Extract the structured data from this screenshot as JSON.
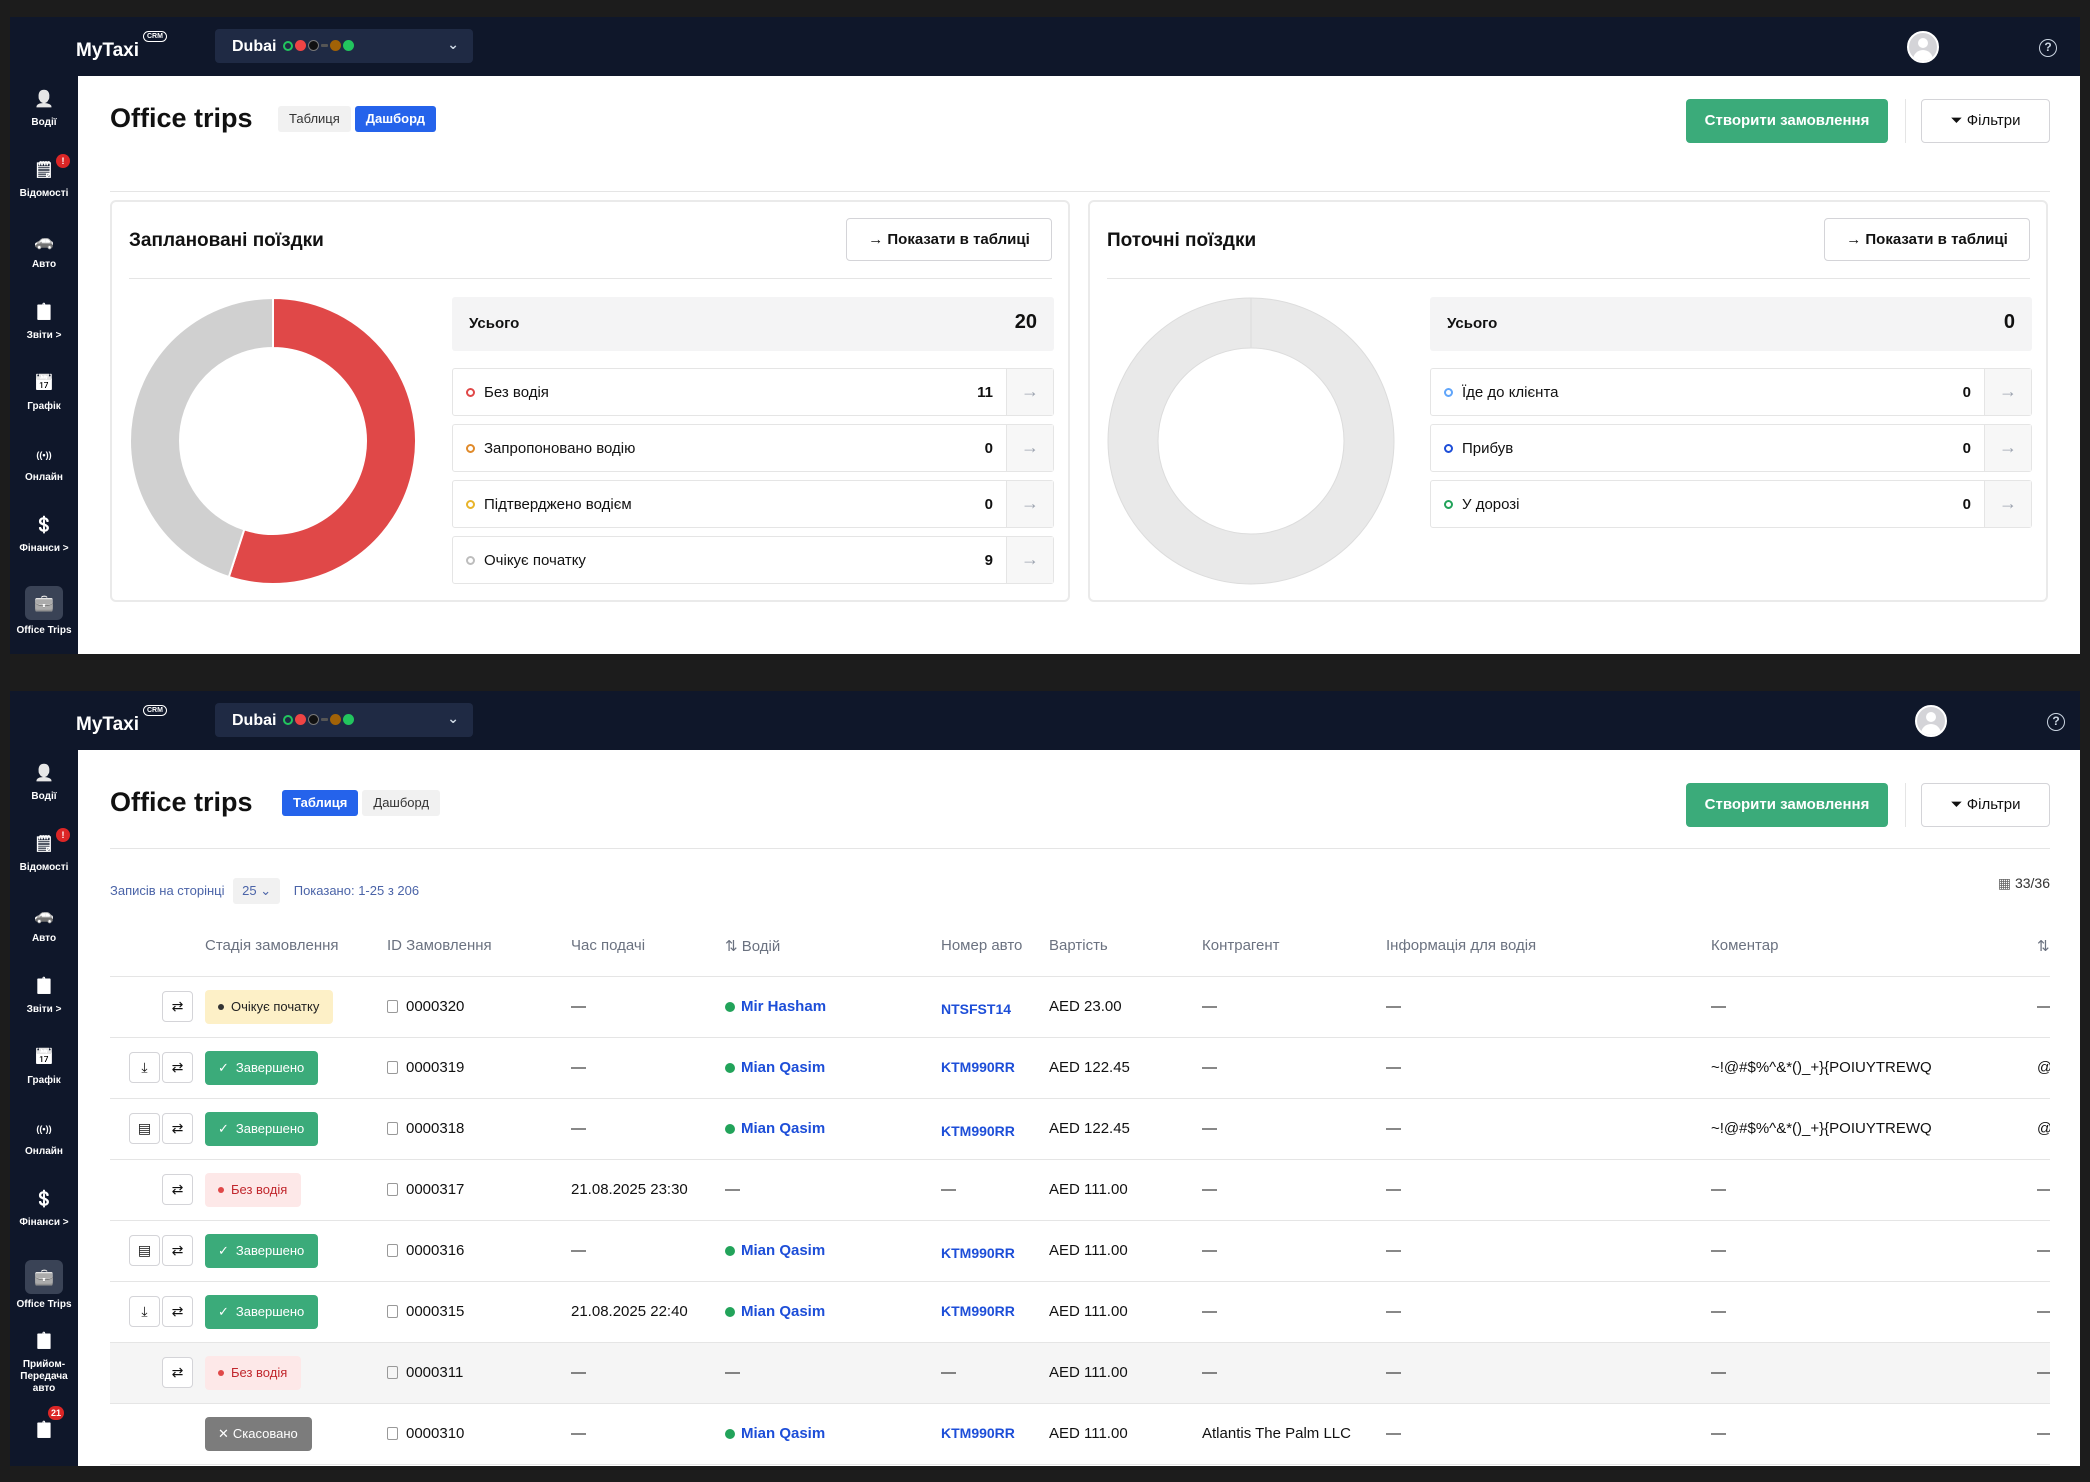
{
  "app": {
    "logo": "MyTaxi",
    "logo_badge": "CRM",
    "city": "Dubai"
  },
  "nav": [
    {
      "label": "Водії",
      "icon": "user-icon"
    },
    {
      "label": "Відомості",
      "icon": "statement-icon",
      "badge": "!"
    },
    {
      "label": "Авто",
      "icon": "car-icon"
    },
    {
      "label": "Звіти >",
      "icon": "report-icon"
    },
    {
      "label": "Графік",
      "icon": "calendar-icon"
    },
    {
      "label": "Онлайн",
      "icon": "broadcast-icon"
    },
    {
      "label": "Фінанси >",
      "icon": "finance-icon"
    },
    {
      "label": "Office Trips",
      "icon": "briefcase-icon",
      "active": true
    }
  ],
  "nav_extra": {
    "label": "Прийом-Передача авто",
    "badge": "21"
  },
  "page": {
    "title": "Office trips",
    "tab_table": "Таблиця",
    "tab_dashboard": "Дашборд",
    "create_btn": "Створити замовлення",
    "filter_btn": "Фільтри"
  },
  "dashboard": {
    "planned": {
      "title": "Заплановані поїздки",
      "show_btn": "Показати в таблиці",
      "total_label": "Усього",
      "total": "20",
      "rows": [
        {
          "label": "Без водія",
          "value": "11",
          "color": "#e04848"
        },
        {
          "label": "Запропоновано водію",
          "value": "0",
          "color": "#e08a2a"
        },
        {
          "label": "Підтверджено водієм",
          "value": "0",
          "color": "#e8b42a"
        },
        {
          "label": "Очікує початку",
          "value": "9",
          "color": "#bdbdbd"
        }
      ]
    },
    "current": {
      "title": "Поточні поїздки",
      "show_btn": "Показати в таблиці",
      "total_label": "Усього",
      "total": "0",
      "rows": [
        {
          "label": "Їде до клієнта",
          "value": "0",
          "color": "#60a5fa"
        },
        {
          "label": "Прибув",
          "value": "0",
          "color": "#1d4ed8"
        },
        {
          "label": "У дорозі",
          "value": "0",
          "color": "#22a35a"
        }
      ]
    }
  },
  "table": {
    "per_page_label": "Записів на сторінці",
    "per_page": "25",
    "shown": "Показано: 1-25 з 206",
    "columns_count": "33/36",
    "headers": [
      "Стадія замовлення",
      "ID Замовлення",
      "Час подачі",
      "Водій",
      "Номер авто",
      "Вартість",
      "Контрагент",
      "Інформація для водія",
      "Коментар"
    ],
    "rows": [
      {
        "stage": "Очікує початку",
        "kind": "wait",
        "id": "0000320",
        "time": "—",
        "driver": "Mir Hasham",
        "car": "NTSFST14",
        "cost": "AED 23.00",
        "counterparty": "—",
        "info": "—",
        "comment": "—",
        "last": "—",
        "act1": ""
      },
      {
        "stage": "Завершено",
        "kind": "done",
        "id": "0000319",
        "time": "—",
        "driver": "Mian Qasim",
        "car": "KTM990RR",
        "cost": "AED 122.45",
        "counterparty": "—",
        "info": "—",
        "comment": "~!@#$%^&*()_+}{POIUYTREWQ",
        "last": "@i",
        "act1": "⤓"
      },
      {
        "stage": "Завершено",
        "kind": "done",
        "id": "0000318",
        "time": "—",
        "driver": "Mian Qasim",
        "car": "KTM990RR",
        "cost": "AED 122.45",
        "counterparty": "—",
        "info": "—",
        "comment": "~!@#$%^&*()_+}{POIUYTREWQ",
        "last": "@i",
        "act1": "▤"
      },
      {
        "stage": "Без водія",
        "kind": "nod",
        "id": "0000317",
        "time": "21.08.2025 23:30",
        "driver": "—",
        "car": "—",
        "cost": "AED 111.00",
        "counterparty": "—",
        "info": "—",
        "comment": "—",
        "last": "—",
        "act1": ""
      },
      {
        "stage": "Завершено",
        "kind": "done",
        "id": "0000316",
        "time": "—",
        "driver": "Mian Qasim",
        "car": "KTM990RR",
        "cost": "AED 111.00",
        "counterparty": "—",
        "info": "—",
        "comment": "—",
        "last": "—",
        "act1": "▤"
      },
      {
        "stage": "Завершено",
        "kind": "done",
        "id": "0000315",
        "time": "21.08.2025 22:40",
        "driver": "Mian Qasim",
        "car": "KTM990RR",
        "cost": "AED 111.00",
        "counterparty": "—",
        "info": "—",
        "comment": "—",
        "last": "—",
        "act1": "⤓"
      },
      {
        "stage": "Без водія",
        "kind": "nod",
        "id": "0000311",
        "time": "—",
        "driver": "—",
        "car": "—",
        "cost": "AED 111.00",
        "counterparty": "—",
        "info": "—",
        "comment": "—",
        "last": "—",
        "act1": ""
      },
      {
        "stage": "Скасовано",
        "kind": "cancel",
        "id": "0000310",
        "time": "—",
        "driver": "Mian Qasim",
        "car": "KTM990RR",
        "cost": "AED 111.00",
        "counterparty": "Atlantis The Palm LLC",
        "info": "—",
        "comment": "—",
        "last": "—",
        "act1": "",
        "noswap": true
      }
    ]
  },
  "colors": {
    "primary": "#2563eb",
    "success": "#3bab7a",
    "danger": "#e04848",
    "navy": "#0f172a"
  }
}
